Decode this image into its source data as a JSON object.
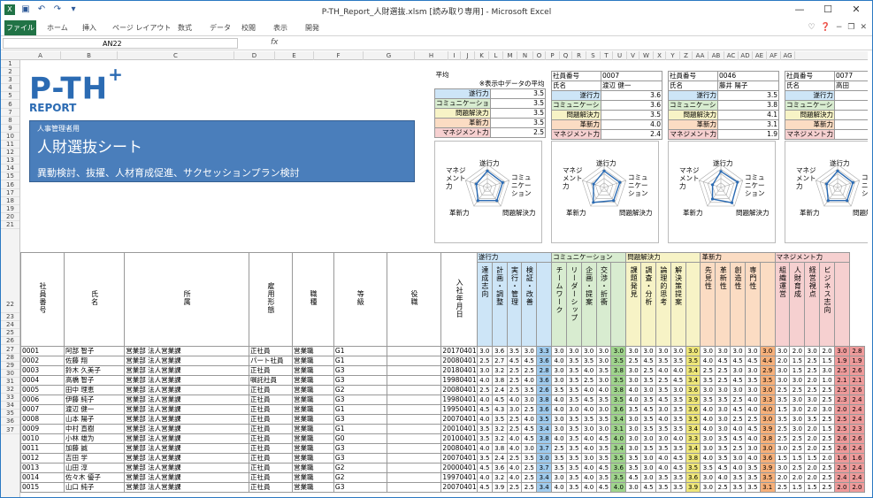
{
  "window": {
    "title": "P-TH_Report_人財選抜.xlsm [読み取り専用] - Microsoft Excel"
  },
  "ribbon": {
    "tabs": [
      "ファイル",
      "ホーム",
      "挿入",
      "ページ レイアウト",
      "数式",
      "データ",
      "校閲",
      "表示",
      "開発"
    ]
  },
  "formula": {
    "namebox": "AN22",
    "fx": "fx"
  },
  "columns": [
    "A",
    "B",
    "C",
    "D",
    "E",
    "F",
    "G",
    "H",
    "I",
    "J",
    "K",
    "L",
    "M",
    "N",
    "O",
    "P",
    "Q",
    "R",
    "S",
    "T",
    "U",
    "V",
    "W",
    "X",
    "Y",
    "Z",
    "AA",
    "AB",
    "AC",
    "AD",
    "AE",
    "AF",
    "AG"
  ],
  "rows": [
    "1",
    "2",
    "3",
    "4",
    "5",
    "6",
    "7",
    "8",
    "9",
    "10",
    "11",
    "12",
    "13",
    "14",
    "15",
    "16",
    "17",
    "18",
    "19",
    "20",
    "21",
    "22",
    "23",
    "24",
    "25",
    "26",
    "27",
    "28",
    "29",
    "30",
    "31",
    "32",
    "33",
    "34",
    "35",
    "36",
    "37"
  ],
  "logo": {
    "text": "P-TH",
    "plus": "+",
    "sub": "REPORT"
  },
  "banner": {
    "small": "人事管理者用",
    "title": "人財選抜シート",
    "desc": "異動検討、抜擢、人材育成促進、サクセッションプラン検討"
  },
  "avg": {
    "title": "平均",
    "note": "※表示中データの平均"
  },
  "categories": [
    "遂行力",
    "コミュニケーション",
    "問題解決力",
    "革新力",
    "マネジメント力"
  ],
  "avgscores": [
    "3.5",
    "3.5",
    "3.5",
    "3.5",
    "2.5"
  ],
  "emp1": {
    "id_label": "社員番号",
    "id": "0007",
    "name_label": "氏名",
    "name": "渡辺 健一",
    "scores": [
      "3.6",
      "3.6",
      "3.5",
      "4.0",
      "2.4"
    ]
  },
  "emp2": {
    "id_label": "社員番号",
    "id": "0046",
    "name_label": "氏名",
    "name": "藤井 陽子",
    "scores": [
      "3.5",
      "3.8",
      "4.1",
      "3.1",
      "1.9"
    ]
  },
  "emp3": {
    "id_label": "社員番号",
    "id": "0077",
    "name_label": "氏名",
    "name": "高田",
    "scores": [
      "",
      "",
      "",
      "",
      ""
    ]
  },
  "radar": {
    "labels": [
      "遂行力",
      "コミュニケーション",
      "問題解決力",
      "革新力",
      "マネジメント力"
    ],
    "levels": [
      0.72,
      0.7,
      0.7,
      0.7,
      0.5
    ],
    "levels1": [
      0.72,
      0.72,
      0.7,
      0.8,
      0.48
    ],
    "levels2": [
      0.7,
      0.76,
      0.82,
      0.62,
      0.38
    ]
  },
  "table": {
    "headers": {
      "id": "社員番号",
      "name": "氏名",
      "dept": "所属",
      "emptype": "雇用形態",
      "job": "職種",
      "grade": "等級",
      "post": "役職",
      "joined": "入社年月日"
    },
    "groups": [
      {
        "name": "遂行力",
        "color": "#cde5f7",
        "items": [
          "達成志向",
          "計画・調整",
          "実行・管理",
          "検証・改善"
        ]
      },
      {
        "name": "コミュニケーション",
        "color": "#d8ecd0",
        "items": [
          "チームワーク",
          "リーダーシップ",
          "企画・提案",
          "交渉・折衝"
        ]
      },
      {
        "name": "問題解決力",
        "color": "#f7f3c6",
        "items": [
          "課題発見",
          "調査・分析",
          "論理的思考",
          "解決策提案"
        ]
      },
      {
        "name": "革新力",
        "color": "#fbdcc3",
        "items": [
          "先見性",
          "革新性",
          "創造性",
          "専門性"
        ]
      },
      {
        "name": "マネジメント力",
        "color": "#f6d0d0",
        "items": [
          "組織運営",
          "人財育成",
          "経営視点",
          "ビジネス志向"
        ]
      }
    ],
    "rows": [
      {
        "id": "0001",
        "name": "阿部 智子",
        "dept": "営業部 法人営業課",
        "type": "正社員",
        "job": "営業職",
        "grade": "G1",
        "date": "20170401",
        "v": [
          "3.0",
          "3.6",
          "3.5",
          "3.0",
          "3.3",
          "3.0",
          "3.0",
          "3.0",
          "3.0",
          "3.0",
          "3.0",
          "3.0",
          "3.0",
          "3.0",
          "3.0",
          "3.0",
          "3.0",
          "3.0",
          "3.0",
          "3.0",
          "3.0",
          "2.0",
          "3.0",
          "2.0",
          "3.0",
          "2.8"
        ]
      },
      {
        "id": "0002",
        "name": "佐藤 翔",
        "dept": "営業部 法人営業課",
        "type": "パート社員",
        "job": "営業職",
        "grade": "G1",
        "date": "20080401",
        "v": [
          "2.5",
          "2.7",
          "4.5",
          "4.5",
          "3.6",
          "4.0",
          "3.5",
          "3.5",
          "3.0",
          "3.5",
          "2.5",
          "4.5",
          "3.5",
          "3.5",
          "3.5",
          "4.0",
          "4.5",
          "4.5",
          "4.5",
          "4.4",
          "2.0",
          "1.5",
          "2.5",
          "1.5",
          "1.9",
          "1.9"
        ]
      },
      {
        "id": "0003",
        "name": "鈴木 久美子",
        "dept": "営業部 法人営業課",
        "type": "正社員",
        "job": "営業職",
        "grade": "G3",
        "date": "20180401",
        "v": [
          "3.0",
          "3.2",
          "2.5",
          "2.5",
          "2.8",
          "3.0",
          "3.5",
          "4.0",
          "3.5",
          "3.8",
          "3.0",
          "2.5",
          "4.0",
          "4.0",
          "3.4",
          "2.5",
          "2.5",
          "3.0",
          "3.0",
          "2.9",
          "3.0",
          "1.5",
          "2.5",
          "3.0",
          "2.5",
          "2.6"
        ]
      },
      {
        "id": "0004",
        "name": "高橋 智子",
        "dept": "営業部 法人営業課",
        "type": "嘱託社員",
        "job": "営業職",
        "grade": "G3",
        "date": "19980401",
        "v": [
          "4.0",
          "3.8",
          "2.5",
          "4.0",
          "3.6",
          "3.0",
          "3.5",
          "2.5",
          "3.0",
          "3.5",
          "3.0",
          "3.5",
          "2.5",
          "4.5",
          "3.4",
          "3.5",
          "2.5",
          "4.5",
          "3.5",
          "3.5",
          "3.0",
          "3.0",
          "2.0",
          "1.0",
          "2.1",
          "2.1"
        ]
      },
      {
        "id": "0005",
        "name": "田中 理恵",
        "dept": "営業部 法人営業課",
        "type": "正社員",
        "job": "営業職",
        "grade": "G2",
        "date": "20080401",
        "v": [
          "2.5",
          "2.4",
          "2.5",
          "3.5",
          "2.6",
          "3.5",
          "3.5",
          "4.0",
          "4.0",
          "3.8",
          "4.0",
          "3.0",
          "3.5",
          "3.0",
          "3.6",
          "3.0",
          "3.0",
          "3.0",
          "3.0",
          "3.0",
          "2.5",
          "2.5",
          "2.5",
          "2.5",
          "2.5",
          "2.6"
        ]
      },
      {
        "id": "0006",
        "name": "伊藤 純子",
        "dept": "営業部 法人営業課",
        "type": "正社員",
        "job": "営業職",
        "grade": "G3",
        "date": "19980401",
        "v": [
          "4.0",
          "4.5",
          "4.0",
          "3.0",
          "3.8",
          "4.0",
          "3.5",
          "4.5",
          "3.5",
          "3.5",
          "4.0",
          "3.5",
          "4.5",
          "3.5",
          "3.9",
          "3.5",
          "3.5",
          "2.5",
          "4.0",
          "3.3",
          "3.5",
          "3.0",
          "3.0",
          "2.5",
          "2.3",
          "2.4"
        ]
      },
      {
        "id": "0007",
        "name": "渡辺 健一",
        "dept": "営業部 法人営業課",
        "type": "正社員",
        "job": "営業職",
        "grade": "G1",
        "date": "19950401",
        "v": [
          "4.5",
          "4.3",
          "3.0",
          "2.5",
          "3.6",
          "4.0",
          "3.0",
          "4.0",
          "3.0",
          "3.6",
          "3.5",
          "4.5",
          "3.0",
          "3.5",
          "3.6",
          "4.0",
          "3.0",
          "4.5",
          "4.0",
          "4.0",
          "1.5",
          "3.0",
          "2.0",
          "3.0",
          "2.0",
          "2.4"
        ]
      },
      {
        "id": "0008",
        "name": "山本 陽子",
        "dept": "営業部 法人営業課",
        "type": "正社員",
        "job": "営業職",
        "grade": "G3",
        "date": "20070401",
        "v": [
          "4.0",
          "3.5",
          "2.5",
          "4.0",
          "3.5",
          "3.0",
          "3.5",
          "3.5",
          "3.5",
          "3.4",
          "3.0",
          "3.5",
          "4.0",
          "3.5",
          "3.5",
          "4.0",
          "3.0",
          "2.5",
          "2.5",
          "3.0",
          "3.5",
          "3.0",
          "3.5",
          "2.5",
          "2.5",
          "2.4"
        ]
      },
      {
        "id": "0009",
        "name": "中村 直樹",
        "dept": "営業部 法人営業課",
        "type": "正社員",
        "job": "営業職",
        "grade": "G1",
        "date": "20010401",
        "v": [
          "3.5",
          "3.2",
          "2.5",
          "4.5",
          "3.4",
          "3.0",
          "3.5",
          "3.0",
          "3.0",
          "3.1",
          "3.0",
          "3.5",
          "3.5",
          "3.5",
          "3.4",
          "4.0",
          "3.0",
          "4.0",
          "4.5",
          "3.9",
          "2.5",
          "3.0",
          "2.0",
          "1.5",
          "2.5",
          "2.3"
        ]
      },
      {
        "id": "0010",
        "name": "小林 雄为",
        "dept": "営業部 法人営業課",
        "type": "正社員",
        "job": "営業職",
        "grade": "G0",
        "date": "20100401",
        "v": [
          "3.5",
          "3.2",
          "4.0",
          "4.5",
          "3.8",
          "4.0",
          "3.5",
          "4.0",
          "4.5",
          "4.0",
          "3.0",
          "3.0",
          "3.0",
          "4.0",
          "3.3",
          "3.0",
          "3.5",
          "4.5",
          "4.0",
          "3.8",
          "2.5",
          "2.5",
          "2.0",
          "2.5",
          "2.6",
          "2.6"
        ]
      },
      {
        "id": "0011",
        "name": "加藤 誠",
        "dept": "営業部 法人営業課",
        "type": "正社員",
        "job": "営業職",
        "grade": "G3",
        "date": "20080401",
        "v": [
          "4.0",
          "3.8",
          "4.0",
          "3.0",
          "3.7",
          "2.5",
          "3.5",
          "4.0",
          "3.5",
          "3.4",
          "3.0",
          "3.5",
          "3.5",
          "3.5",
          "3.4",
          "3.0",
          "3.5",
          "2.5",
          "3.0",
          "3.0",
          "3.0",
          "2.5",
          "2.0",
          "2.5",
          "2.6",
          "2.4"
        ]
      },
      {
        "id": "0012",
        "name": "吉田 学",
        "dept": "営業部 法人営業課",
        "type": "正社員",
        "job": "営業職",
        "grade": "G3",
        "date": "20070401",
        "v": [
          "3.5",
          "2.4",
          "2.5",
          "3.5",
          "3.0",
          "3.5",
          "3.5",
          "3.0",
          "3.5",
          "3.5",
          "3.5",
          "3.0",
          "4.0",
          "4.5",
          "3.8",
          "4.0",
          "3.5",
          "3.0",
          "4.0",
          "3.6",
          "1.5",
          "1.5",
          "1.5",
          "2.0",
          "1.6",
          "1.6"
        ]
      },
      {
        "id": "0013",
        "name": "山田 淳",
        "dept": "営業部 法人営業課",
        "type": "正社員",
        "job": "営業職",
        "grade": "G2",
        "date": "20000401",
        "v": [
          "4.5",
          "3.6",
          "4.0",
          "2.5",
          "3.7",
          "3.5",
          "3.5",
          "4.0",
          "4.5",
          "3.6",
          "3.5",
          "3.0",
          "4.0",
          "4.5",
          "3.5",
          "3.5",
          "4.5",
          "4.0",
          "3.5",
          "3.9",
          "3.0",
          "2.5",
          "2.0",
          "2.5",
          "2.5",
          "2.4"
        ]
      },
      {
        "id": "0014",
        "name": "佐々木 優子",
        "dept": "営業部 法人営業課",
        "type": "正社員",
        "job": "営業職",
        "grade": "G2",
        "date": "19970401",
        "v": [
          "4.0",
          "3.2",
          "4.0",
          "2.5",
          "3.4",
          "3.0",
          "3.5",
          "4.0",
          "3.5",
          "3.5",
          "4.5",
          "3.0",
          "3.5",
          "3.5",
          "3.6",
          "3.0",
          "4.0",
          "3.5",
          "3.5",
          "3.5",
          "2.0",
          "2.0",
          "2.0",
          "2.5",
          "2.4",
          "2.4"
        ]
      },
      {
        "id": "0015",
        "name": "山口 純子",
        "dept": "営業部 法人営業課",
        "type": "正社員",
        "job": "営業職",
        "grade": "G3",
        "date": "20070401",
        "v": [
          "4.5",
          "3.9",
          "2.5",
          "2.5",
          "3.4",
          "4.0",
          "3.5",
          "4.0",
          "4.5",
          "4.0",
          "3.0",
          "4.5",
          "3.5",
          "3.5",
          "3.9",
          "3.0",
          "2.5",
          "3.5",
          "3.5",
          "3.1",
          "2.5",
          "1.5",
          "1.5",
          "2.5",
          "2.0",
          "2.0"
        ]
      }
    ]
  }
}
